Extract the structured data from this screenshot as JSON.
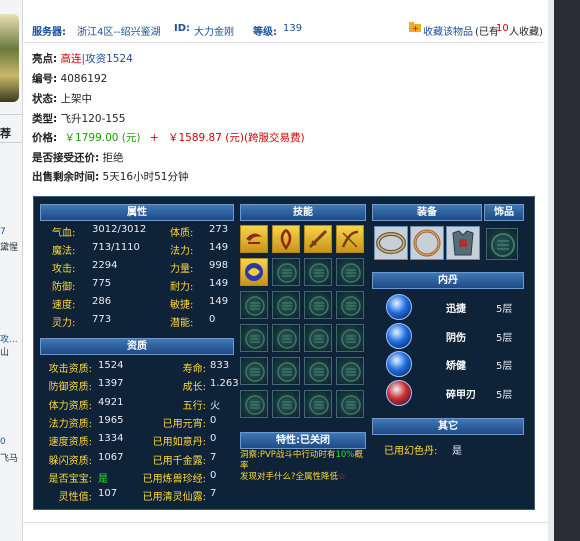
{
  "left": {
    "tab": "荐",
    "items": [
      "7",
      "黛惺",
      "攻...",
      "山",
      "0",
      "飞马"
    ]
  },
  "header": {
    "server_label": "服务器:",
    "server_value": "浙江4区--绍兴鉴湖",
    "id_label": "ID:",
    "id_value": "大力金刚",
    "level_label": "等级:",
    "level_value": "139",
    "fav_label": "收藏该物品",
    "fav_count_prefix": "(已有",
    "fav_count": "10",
    "fav_count_suffix": "人收藏)"
  },
  "info": {
    "highlight_label": "亮点:",
    "highlight_1": "高连",
    "highlight_sep": "|",
    "highlight_2": "攻资1524",
    "code_label": "编号:",
    "code_value": "4086192",
    "status_label": "状态:",
    "status_value": "上架中",
    "type_label": "类型:",
    "type_value": "飞升120-155",
    "price_label": "价格:",
    "price_value": "￥1799.00 (元)",
    "price_plus": "+",
    "price_fee": "￥1589.87 (元)(跨服交易费)",
    "bargain_label": "是否接受还价:",
    "bargain_value": "拒绝",
    "remain_label": "出售剩余时间:",
    "remain_value": "5天16小时51分钟"
  },
  "panel": {
    "attr_title": "属性",
    "skill_title": "技能",
    "equip_title": "装备",
    "acc_title": "饰品",
    "neigong_title": "内丹",
    "other_title": "其它",
    "zizhi_title": "资质",
    "trait_title": "特性:已关闭",
    "trait_desc_1": "洞察:PVP战斗中行动时有",
    "trait_desc_pct": "10%",
    "trait_desc_2": "概率",
    "trait_desc_3": "发现对手什么?全属性降低",
    "trait_desc_end": "☆",
    "attrs": [
      {
        "l1": "气血:",
        "v1": "3012/3012",
        "l2": "体质:",
        "v2": "273"
      },
      {
        "l1": "魔法:",
        "v1": "713/1110",
        "l2": "法力:",
        "v2": "149"
      },
      {
        "l1": "攻击:",
        "v1": "2294",
        "l2": "力量:",
        "v2": "998"
      },
      {
        "l1": "防御:",
        "v1": "775",
        "l2": "耐力:",
        "v2": "149"
      },
      {
        "l1": "速度:",
        "v1": "286",
        "l2": "敏捷:",
        "v2": "149"
      },
      {
        "l1": "灵力:",
        "v1": "773",
        "l2": "潜能:",
        "v2": "0"
      }
    ],
    "zizhi": [
      {
        "l1": "攻击资质:",
        "v1": "1524",
        "l2": "寿命:",
        "v2": "833"
      },
      {
        "l1": "防御资质:",
        "v1": "1397",
        "l2": "成长:",
        "v2": "1.263"
      },
      {
        "l1": "体力资质:",
        "v1": "4921",
        "l2": "五行:",
        "v2": "火"
      },
      {
        "l1": "法力资质:",
        "v1": "1965",
        "l2": "已用元宵:",
        "v2": "0"
      },
      {
        "l1": "速度资质:",
        "v1": "1334",
        "l2": "已用如意丹:",
        "v2": "0"
      },
      {
        "l1": "躲闪资质:",
        "v1": "1067",
        "l2": "已用千金露:",
        "v2": "7"
      },
      {
        "l1": "是否宝宝:",
        "v1": "是",
        "l2": "已用炼兽珍经:",
        "v2": "0"
      },
      {
        "l1": "灵性值:",
        "v1": "107",
        "l2": "已用清灵仙露:",
        "v2": "7"
      }
    ],
    "neigong": [
      {
        "name": "迅捷",
        "level": "5层",
        "color": "#1e6fe0"
      },
      {
        "name": "阴伤",
        "level": "5层",
        "color": "#1e6fe0"
      },
      {
        "name": "矫健",
        "level": "5层",
        "color": "#1e6fe0"
      },
      {
        "name": "碎甲刃",
        "level": "5层",
        "color": "#d02a2a"
      }
    ],
    "other_label": "已用幻色丹:",
    "other_value": "是"
  }
}
